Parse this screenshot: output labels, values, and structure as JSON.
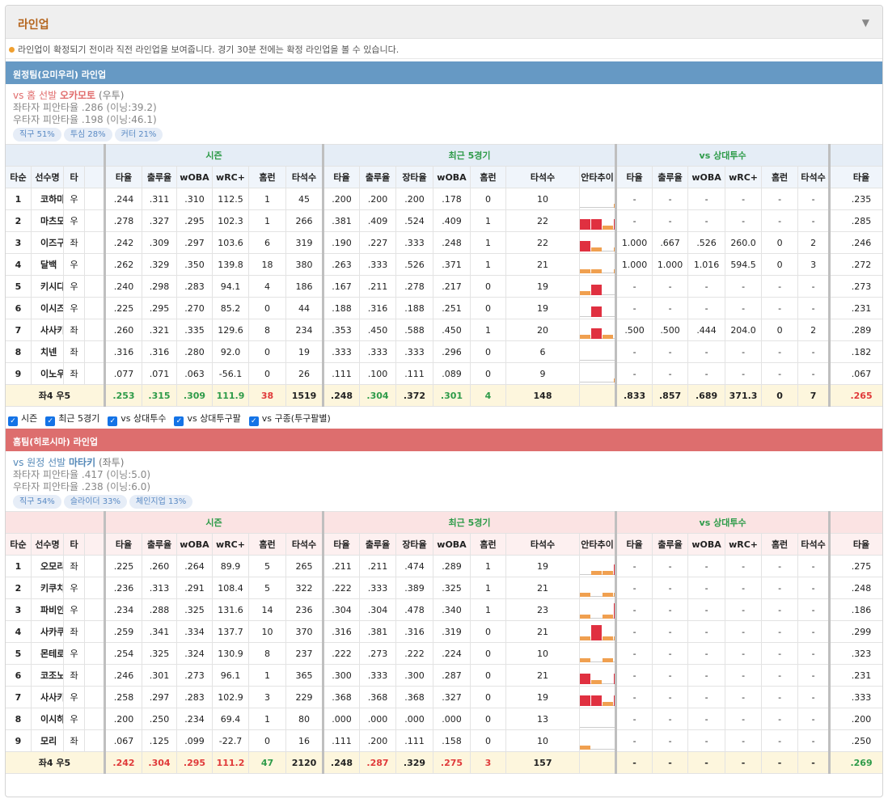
{
  "panel": {
    "title": "라인업",
    "toggle": "▼",
    "notice": "라인업이 확정되기 전이라 직전 라인업을 보여줍니다. 경기 30분 전에는 확정 라인업을 볼 수 있습니다."
  },
  "headers": {
    "groups": [
      "시즌",
      "최근 5경기",
      "vs 상대투수"
    ],
    "order": "타순",
    "name": "선수명",
    "hand": "타",
    "season": [
      "타율",
      "출루율",
      "wOBA",
      "wRC+",
      "홈런",
      "타석수"
    ],
    "recent": [
      "타율",
      "출루율",
      "장타율",
      "wOBA",
      "홈런",
      "타석수",
      "안타추이"
    ],
    "vs": [
      "타율",
      "출루율",
      "wOBA",
      "wRC+",
      "홈런",
      "타석수"
    ],
    "extra": "타율"
  },
  "checks": [
    "시즌",
    "최근 5경기",
    "vs 상대투수",
    "vs 상대투구팔",
    "vs 구종(투구팔별)"
  ],
  "colors": {
    "spark_orange": "#f0a050",
    "spark_red": "#e03040"
  },
  "away": {
    "title": "원정팀(요미우리) 라인업",
    "pitcher": {
      "prefix": "vs 홈 선발",
      "name": "오카모토",
      "hand": "(우투)",
      "left": "좌타자 피안타율 .286 (이닝:39.2)",
      "right": "우타자 피안타율 .198 (이닝:46.1)"
    },
    "pills": [
      "직구 51%",
      "투심 28%",
      "커터 21%"
    ],
    "rows": [
      {
        "order": "1",
        "name": "코하마",
        "hand": "우",
        "season": [
          ".244",
          ".311",
          ".310",
          "112.5",
          "1",
          "45"
        ],
        "recent": [
          ".200",
          ".200",
          ".200",
          ".178",
          "0",
          "10"
        ],
        "spark": [
          0,
          0,
          0,
          1,
          1
        ],
        "vs": [
          "-",
          "-",
          "-",
          "-",
          "-",
          "-"
        ],
        "extra": ".235"
      },
      {
        "order": "2",
        "name": "마츠모토",
        "hand": "우",
        "season": [
          ".278",
          ".327",
          ".295",
          "102.3",
          "1",
          "266"
        ],
        "recent": [
          ".381",
          ".409",
          ".524",
          ".409",
          "1",
          "22"
        ],
        "spark": [
          3,
          3,
          1,
          3,
          1
        ],
        "vs": [
          "-",
          "-",
          "-",
          "-",
          "-",
          "-"
        ],
        "extra": ".285"
      },
      {
        "order": "3",
        "name": "이즈구치",
        "hand": "좌",
        "season": [
          ".242",
          ".309",
          ".297",
          "103.6",
          "6",
          "319"
        ],
        "recent": [
          ".190",
          ".227",
          ".333",
          ".248",
          "1",
          "22"
        ],
        "spark": [
          3,
          1,
          0,
          1,
          0
        ],
        "vs": [
          "1.000",
          ".667",
          ".526",
          "260.0",
          "0",
          "2"
        ],
        "extra": ".246"
      },
      {
        "order": "4",
        "name": "달백",
        "hand": "우",
        "season": [
          ".262",
          ".329",
          ".350",
          "139.8",
          "18",
          "380"
        ],
        "recent": [
          ".263",
          ".333",
          ".526",
          ".371",
          "1",
          "21"
        ],
        "spark": [
          1,
          1,
          0,
          1,
          3
        ],
        "vs": [
          "1.000",
          "1.000",
          "1.016",
          "594.5",
          "0",
          "3"
        ],
        "extra": ".272"
      },
      {
        "order": "5",
        "name": "키시다",
        "hand": "우",
        "season": [
          ".240",
          ".298",
          ".283",
          "94.1",
          "4",
          "186"
        ],
        "recent": [
          ".167",
          ".211",
          ".278",
          ".217",
          "0",
          "19"
        ],
        "spark": [
          1,
          3,
          0,
          0,
          0
        ],
        "vs": [
          "-",
          "-",
          "-",
          "-",
          "-",
          "-"
        ],
        "extra": ".273"
      },
      {
        "order": "6",
        "name": "이시즈카",
        "hand": "우",
        "season": [
          ".225",
          ".295",
          ".270",
          "85.2",
          "0",
          "44"
        ],
        "recent": [
          ".188",
          ".316",
          ".188",
          ".251",
          "0",
          "19"
        ],
        "spark": [
          0,
          3,
          0,
          0,
          0
        ],
        "vs": [
          "-",
          "-",
          "-",
          "-",
          "-",
          "-"
        ],
        "extra": ".231"
      },
      {
        "order": "7",
        "name": "사사키",
        "hand": "좌",
        "season": [
          ".260",
          ".321",
          ".335",
          "129.6",
          "8",
          "234"
        ],
        "recent": [
          ".353",
          ".450",
          ".588",
          ".450",
          "1",
          "20"
        ],
        "spark": [
          1,
          3,
          1,
          0,
          1
        ],
        "vs": [
          ".500",
          ".500",
          ".444",
          "204.0",
          "0",
          "2"
        ],
        "extra": ".289"
      },
      {
        "order": "8",
        "name": "치넨",
        "hand": "좌",
        "season": [
          ".316",
          ".316",
          ".280",
          "92.0",
          "0",
          "19"
        ],
        "recent": [
          ".333",
          ".333",
          ".333",
          ".296",
          "0",
          "6"
        ],
        "spark": [
          0,
          0,
          0,
          0,
          3
        ],
        "vs": [
          "-",
          "-",
          "-",
          "-",
          "-",
          "-"
        ],
        "extra": ".182"
      },
      {
        "order": "9",
        "name": "이노우에",
        "hand": "좌",
        "season": [
          ".077",
          ".071",
          ".063",
          "-56.1",
          "0",
          "26"
        ],
        "recent": [
          ".111",
          ".100",
          ".111",
          ".089",
          "0",
          "9"
        ],
        "spark": [
          0,
          0,
          0,
          1,
          0
        ],
        "vs": [
          "-",
          "-",
          "-",
          "-",
          "-",
          "-"
        ],
        "extra": ".067"
      }
    ],
    "sum": {
      "label": "좌4 우5",
      "season": [
        ".253",
        ".315",
        ".309",
        "111.9",
        "38",
        "1519"
      ],
      "recent": [
        ".248",
        ".304",
        ".372",
        ".301",
        "4",
        "148"
      ],
      "vs": [
        ".833",
        ".857",
        ".689",
        "371.3",
        "0",
        "7"
      ],
      "extra": ".265"
    }
  },
  "home": {
    "title": "홈팀(히로시마) 라인업",
    "pitcher": {
      "prefix": "vs 원정 선발",
      "name": "마타키",
      "hand": "(좌투)",
      "left": "좌타자 피안타율 .417 (이닝:5.0)",
      "right": "우타자 피안타율 .238 (이닝:6.0)"
    },
    "pills": [
      "직구 54%",
      "슬라이더 33%",
      "체인지업 13%"
    ],
    "rows": [
      {
        "order": "1",
        "name": "오모리",
        "hand": "좌",
        "season": [
          ".225",
          ".260",
          ".264",
          "89.9",
          "5",
          "265"
        ],
        "recent": [
          ".211",
          ".211",
          ".474",
          ".289",
          "1",
          "19"
        ],
        "spark": [
          0,
          1,
          1,
          3,
          0
        ],
        "vs": [
          "-",
          "-",
          "-",
          "-",
          "-",
          "-"
        ],
        "extra": ".275"
      },
      {
        "order": "2",
        "name": "키쿠치",
        "hand": "우",
        "season": [
          ".236",
          ".313",
          ".291",
          "108.4",
          "5",
          "322"
        ],
        "recent": [
          ".222",
          ".333",
          ".389",
          ".325",
          "1",
          "21"
        ],
        "spark": [
          1,
          0,
          1,
          1,
          3
        ],
        "vs": [
          "-",
          "-",
          "-",
          "-",
          "-",
          "-"
        ],
        "extra": ".248"
      },
      {
        "order": "3",
        "name": "파비안",
        "hand": "우",
        "season": [
          ".234",
          ".288",
          ".325",
          "131.6",
          "14",
          "236"
        ],
        "recent": [
          ".304",
          ".304",
          ".478",
          ".340",
          "1",
          "23"
        ],
        "spark": [
          1,
          0,
          1,
          4,
          3
        ],
        "vs": [
          "-",
          "-",
          "-",
          "-",
          "-",
          "-"
        ],
        "extra": ".186"
      },
      {
        "order": "4",
        "name": "사카쿠라",
        "hand": "좌",
        "season": [
          ".259",
          ".341",
          ".334",
          "137.7",
          "10",
          "370"
        ],
        "recent": [
          ".316",
          ".381",
          ".316",
          ".319",
          "0",
          "21"
        ],
        "spark": [
          1,
          4,
          1,
          1,
          0
        ],
        "vs": [
          "-",
          "-",
          "-",
          "-",
          "-",
          "-"
        ],
        "extra": ".299"
      },
      {
        "order": "5",
        "name": "몬테로",
        "hand": "우",
        "season": [
          ".254",
          ".325",
          ".324",
          "130.9",
          "8",
          "237"
        ],
        "recent": [
          ".222",
          ".273",
          ".222",
          ".224",
          "0",
          "10"
        ],
        "spark": [
          1,
          0,
          1,
          0,
          0
        ],
        "vs": [
          "-",
          "-",
          "-",
          "-",
          "-",
          "-"
        ],
        "extra": ".323"
      },
      {
        "order": "6",
        "name": "코조노",
        "hand": "좌",
        "season": [
          ".246",
          ".301",
          ".273",
          "96.1",
          "1",
          "365"
        ],
        "recent": [
          ".300",
          ".333",
          ".300",
          ".287",
          "0",
          "21"
        ],
        "spark": [
          3,
          1,
          0,
          3,
          1
        ],
        "vs": [
          "-",
          "-",
          "-",
          "-",
          "-",
          "-"
        ],
        "extra": ".231"
      },
      {
        "order": "7",
        "name": "사사키",
        "hand": "우",
        "season": [
          ".258",
          ".297",
          ".283",
          "102.9",
          "3",
          "229"
        ],
        "recent": [
          ".368",
          ".368",
          ".368",
          ".327",
          "0",
          "19"
        ],
        "spark": [
          3,
          3,
          1,
          3,
          0
        ],
        "vs": [
          "-",
          "-",
          "-",
          "-",
          "-",
          "-"
        ],
        "extra": ".333"
      },
      {
        "order": "8",
        "name": "이시하라",
        "hand": "우",
        "season": [
          ".200",
          ".250",
          ".234",
          "69.4",
          "1",
          "80"
        ],
        "recent": [
          ".000",
          ".000",
          ".000",
          ".000",
          "0",
          "13"
        ],
        "spark": [
          0,
          0,
          0,
          0,
          0
        ],
        "vs": [
          "-",
          "-",
          "-",
          "-",
          "-",
          "-"
        ],
        "extra": ".200"
      },
      {
        "order": "9",
        "name": "모리",
        "hand": "좌",
        "season": [
          ".067",
          ".125",
          ".099",
          "-22.7",
          "0",
          "16"
        ],
        "recent": [
          ".111",
          ".200",
          ".111",
          ".158",
          "0",
          "10"
        ],
        "spark": [
          1,
          0,
          0,
          0,
          0
        ],
        "vs": [
          "-",
          "-",
          "-",
          "-",
          "-",
          "-"
        ],
        "extra": ".250"
      }
    ],
    "sum": {
      "label": "좌4 우5",
      "season": [
        ".242",
        ".304",
        ".295",
        "111.2",
        "47",
        "2120"
      ],
      "recent": [
        ".248",
        ".287",
        ".329",
        ".275",
        "3",
        "157"
      ],
      "vs": [
        "-",
        "-",
        "-",
        "-",
        "-",
        "-"
      ],
      "extra": ".269"
    }
  }
}
